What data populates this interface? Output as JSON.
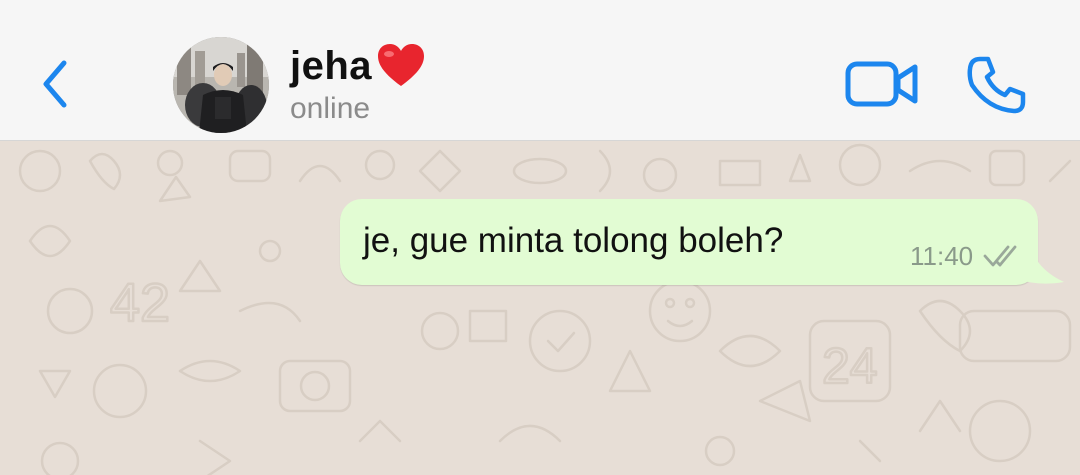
{
  "header": {
    "contact_name": "jeha",
    "name_emoji_icon": "red-heart-icon",
    "status": "online",
    "back_icon": "chevron-left-icon",
    "video_icon": "video-camera-icon",
    "phone_icon": "phone-icon",
    "accent_color": "#1c86ee"
  },
  "messages": [
    {
      "direction": "outgoing",
      "text": "je, gue minta tolong boleh?",
      "time": "11:40",
      "status_icon": "double-check-icon",
      "bubble_color": "#e2fcd3"
    }
  ],
  "colors": {
    "header_bg": "#f6f6f6",
    "chat_bg": "#e7ded6",
    "status_text": "#8b8b8b"
  }
}
